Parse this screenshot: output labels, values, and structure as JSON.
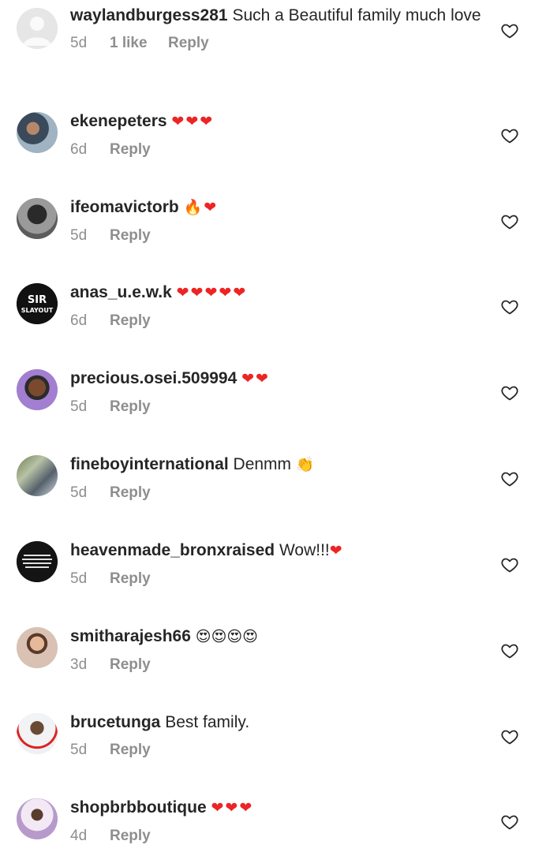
{
  "comments": [
    {
      "username": "waylandburgess281",
      "text": "Such a Beautiful family much love",
      "emoji": "",
      "time": "5d",
      "likes": "1 like",
      "reply": "Reply",
      "avatar_color": "#e3e3e3"
    },
    {
      "username": "ekenepeters",
      "text": "",
      "emoji": "❤❤❤",
      "time": "6d",
      "likes": "",
      "reply": "Reply",
      "avatar_color": "#6e7a86"
    },
    {
      "username": "ifeomavictorb",
      "text": "",
      "emoji": "🔥❤",
      "time": "5d",
      "likes": "",
      "reply": "Reply",
      "avatar_color": "#777777"
    },
    {
      "username": "anas_u.e.w.k",
      "text": "",
      "emoji": "❤❤❤❤❤",
      "time": "6d",
      "likes": "",
      "reply": "Reply",
      "avatar_color": "#111111"
    },
    {
      "username": "precious.osei.509994",
      "text": "",
      "emoji": "❤❤",
      "time": "5d",
      "likes": "",
      "reply": "Reply",
      "avatar_color": "#8a6aa8"
    },
    {
      "username": "fineboyinternational",
      "text": "Denmm",
      "emoji": "👏",
      "time": "5d",
      "likes": "",
      "reply": "Reply",
      "avatar_color": "#8fa37a"
    },
    {
      "username": "heavenmade_bronxraised",
      "text": "Wow!!!",
      "emoji": "❤",
      "time": "5d",
      "likes": "",
      "reply": "Reply",
      "avatar_color": "#1a1a1a"
    },
    {
      "username": "smitharajesh66",
      "text": "",
      "emoji": "😍😍😍😍",
      "time": "3d",
      "likes": "",
      "reply": "Reply",
      "avatar_color": "#b89a82"
    },
    {
      "username": "brucetunga",
      "text": "Best family.",
      "emoji": "",
      "time": "5d",
      "likes": "",
      "reply": "Reply",
      "avatar_color": "#e9ecef"
    },
    {
      "username": "shopbrbboutique",
      "text": "",
      "emoji": "❤❤❤",
      "time": "4d",
      "likes": "",
      "reply": "Reply",
      "avatar_color": "#d9c8e4"
    }
  ],
  "icons": {
    "like": "heart-outline-icon"
  },
  "colors": {
    "heart_emoji": "#ed2424",
    "meta_text": "#8e8e8e",
    "text": "#262626"
  }
}
